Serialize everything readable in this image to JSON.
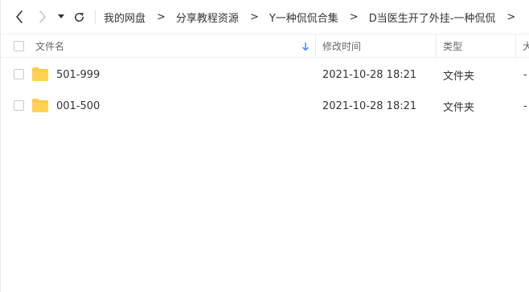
{
  "toolbar": {
    "back_icon": "chevron-left-icon",
    "forward_icon": "chevron-right-icon",
    "history_icon": "caret-down-icon",
    "refresh_icon": "refresh-icon"
  },
  "breadcrumb": {
    "items": [
      {
        "label": "我的网盘"
      },
      {
        "label": "分享教程资源"
      },
      {
        "label": "Y一种侃侃合集"
      },
      {
        "label": "D当医生开了外挂-一种侃侃"
      }
    ],
    "separator": ">"
  },
  "table": {
    "columns": {
      "name": "文件名",
      "modified": "修改时间",
      "type": "类型",
      "size": "大"
    },
    "sort_icon": "arrow-down-icon",
    "accent_color": "#3b8cff",
    "rows": [
      {
        "name": "501-999",
        "modified": "2021-10-28 18:21",
        "type": "文件夹",
        "size": "-"
      },
      {
        "name": "001-500",
        "modified": "2021-10-28 18:21",
        "type": "文件夹",
        "size": "-"
      }
    ],
    "folder_color": "#ffc94a"
  }
}
